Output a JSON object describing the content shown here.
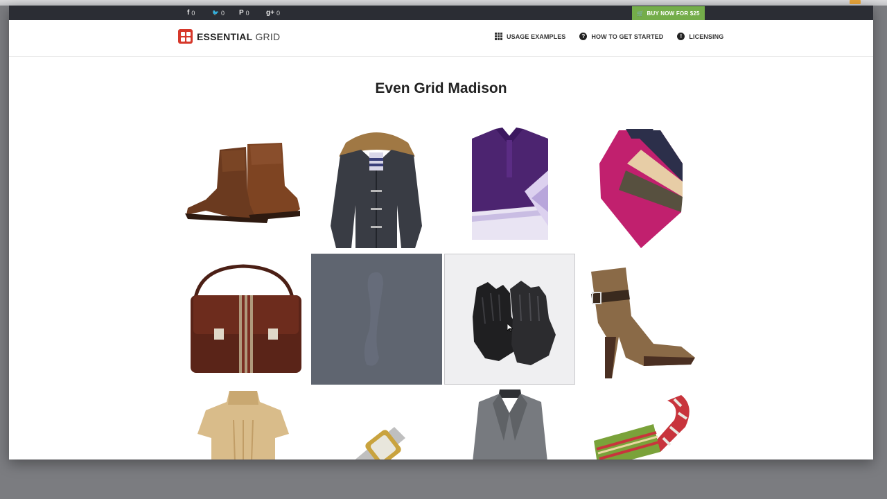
{
  "topbar": {
    "social": [
      {
        "icon": "facebook-icon",
        "glyph": "f",
        "count": "0"
      },
      {
        "icon": "twitter-icon",
        "glyph": "🐦",
        "count": "0"
      },
      {
        "icon": "pinterest-icon",
        "glyph": "P",
        "count": "0"
      },
      {
        "icon": "googleplus-icon",
        "glyph": "g+",
        "count": "0"
      }
    ],
    "buy_label": "BUY NOW FOR $25",
    "buy_color": "#74ad4a"
  },
  "header": {
    "logo_bold": "ESSENTIAL",
    "logo_light": "GRID",
    "logo_color": "#d6382b",
    "nav": [
      {
        "label": "USAGE EXAMPLES",
        "icon": "grid-icon"
      },
      {
        "label": "HOW TO GET STARTED",
        "icon": "question-icon"
      },
      {
        "label": "LICENSING",
        "icon": "info-icon"
      }
    ]
  },
  "main": {
    "title": "Even Grid Madison",
    "items": [
      "boots",
      "parka-jacket",
      "purple-polo-shirt",
      "striped-poncho",
      "leather-messenger-bag",
      "hovered-item",
      "leather-gloves",
      "high-heel-ankle-boot",
      "turtleneck-sweater",
      "wristwatch",
      "grey-coat",
      "striped-scarf"
    ]
  }
}
